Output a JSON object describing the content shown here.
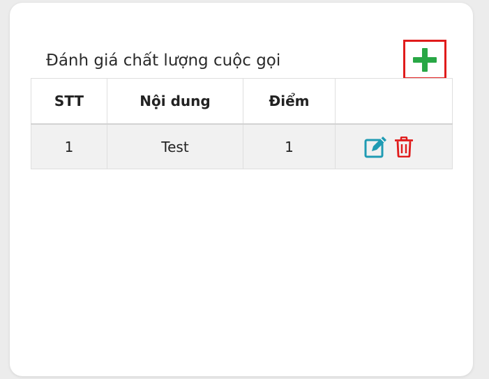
{
  "card": {
    "title": "Đánh giá chất lượng cuộc gọi"
  },
  "toolbar": {
    "add_icon": "plus-icon"
  },
  "table": {
    "columns": [
      "STT",
      "Nội dung",
      "Điểm",
      ""
    ],
    "rows": [
      {
        "stt": "1",
        "content": "Test",
        "score": "1",
        "actions": [
          "edit-icon",
          "trash-icon"
        ]
      }
    ]
  },
  "colors": {
    "add": "#28a745",
    "add_border": "#e01b1b",
    "edit": "#1f9bb3",
    "delete": "#e01b1b"
  }
}
